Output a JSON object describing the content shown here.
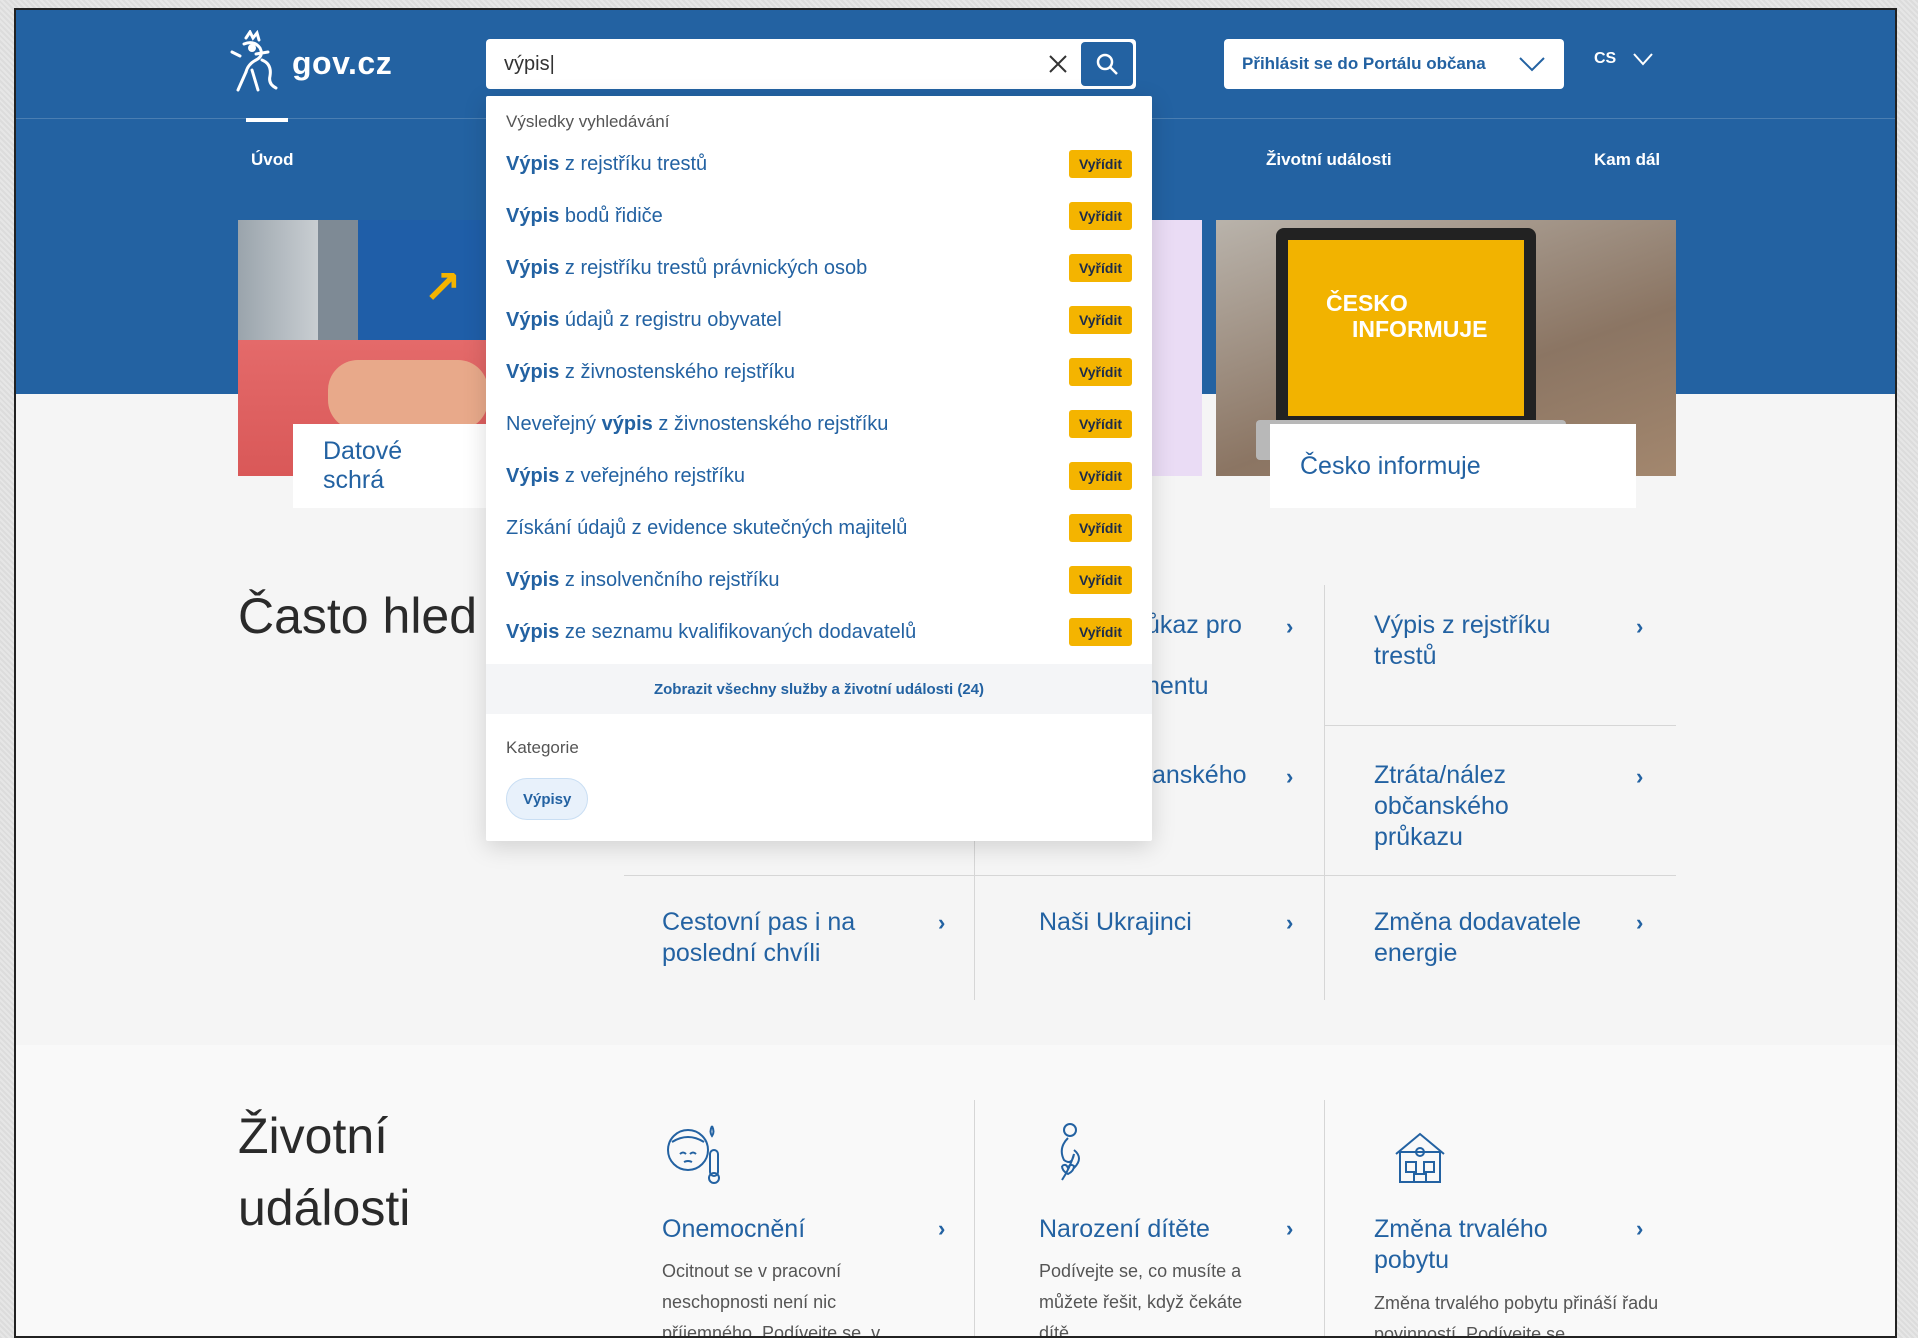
{
  "header": {
    "logo_text": "gov.cz",
    "search": {
      "value": "výpis|",
      "placeholder": ""
    },
    "login_label": "Přihlásit se do Portálu občana",
    "lang_label": "CS"
  },
  "nav": {
    "items": [
      {
        "label": "Úvod"
      },
      {
        "label": "Životní události"
      },
      {
        "label": "Kam dál"
      }
    ]
  },
  "hero": {
    "cards": [
      {
        "label": "Datové schrá"
      },
      {
        "label": "Česko informuje"
      }
    ],
    "screen_text": {
      "line1": "ČESKO",
      "line2": "INFORMUJE"
    }
  },
  "often": {
    "title": "Často hled",
    "cells": [
      {
        "label": "ůkaz pro",
        "label2": "nentu"
      },
      {
        "label": "Výpis z rejstříku trestů"
      },
      {
        "label": "anského"
      },
      {
        "label": "Ztráta/nález občanského průkazu"
      },
      {
        "label": "Cestovní pas i na poslední chvíli"
      },
      {
        "label": "Naši Ukrajinci"
      },
      {
        "label": "Změna dodavatele energie"
      }
    ],
    "chevron": "›"
  },
  "life": {
    "title": "Životní události",
    "items": [
      {
        "title": "Onemocnění",
        "desc": "Ocitnout se v pracovní neschopnosti není nic příjemného. Podívejte se, v",
        "icon": "sick-face-icon"
      },
      {
        "title": "Narození dítěte",
        "desc": "Podívejte se, co musíte a můžete řešit, když čekáte dítě.",
        "icon": "pregnancy-icon"
      },
      {
        "title": "Změna trvalého pobytu",
        "desc": "Změna trvalého pobytu přináší řadu povinností. Podívejte se",
        "icon": "house-icon"
      }
    ]
  },
  "dropdown": {
    "results_heading": "Výsledky vyhledávání",
    "badge_label": "Vyřídit",
    "results": [
      {
        "bold": "Výpis",
        "rest": " z rejstříku trestů",
        "pre": ""
      },
      {
        "bold": "Výpis",
        "rest": " bodů řidiče",
        "pre": ""
      },
      {
        "bold": "Výpis",
        "rest": " z rejstříku trestů právnických osob",
        "pre": ""
      },
      {
        "bold": "Výpis",
        "rest": " údajů z registru obyvatel",
        "pre": ""
      },
      {
        "bold": "Výpis",
        "rest": " z živnostenského rejstříku",
        "pre": ""
      },
      {
        "bold": "výpis",
        "rest": " z živnostenského rejstříku",
        "pre": "Neveřejný "
      },
      {
        "bold": "Výpis",
        "rest": " z veřejného rejstříku",
        "pre": ""
      },
      {
        "bold": "",
        "rest": "Získání údajů z evidence skutečných majitelů",
        "pre": ""
      },
      {
        "bold": "Výpis",
        "rest": " z insolvenčního rejstříku",
        "pre": ""
      },
      {
        "bold": "Výpis",
        "rest": " ze seznamu kvalifikovaných dodavatelů",
        "pre": ""
      }
    ],
    "show_all": "Zobrazit všechny služby a životní události (24)",
    "categories_heading": "Kategorie",
    "category_chip": "Výpisy"
  },
  "colors": {
    "brand": "#2362a2",
    "badge": "#f4b400"
  }
}
